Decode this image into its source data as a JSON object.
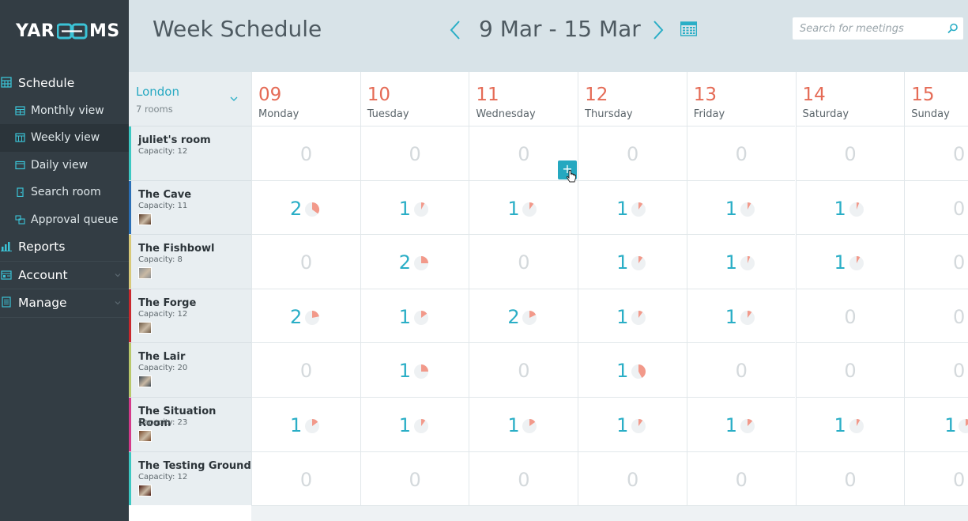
{
  "app": {
    "logo_left": "YAR",
    "logo_right": "MS",
    "page_title": "Week Schedule",
    "week_range": "9 Mar - 15 Mar",
    "search_placeholder": "Search for meetings",
    "accent_color": "#2aaec6",
    "date_color": "#e56b56"
  },
  "sidebar": {
    "items": [
      {
        "label": "Schedule",
        "type": "main",
        "icon": "schedule-icon"
      },
      {
        "label": "Monthly view",
        "type": "sub",
        "icon": "monthly-view-icon"
      },
      {
        "label": "Weekly view",
        "type": "sub",
        "icon": "weekly-view-icon",
        "active": true
      },
      {
        "label": "Daily view",
        "type": "sub",
        "icon": "daily-view-icon"
      },
      {
        "label": "Search room",
        "type": "sub",
        "icon": "search-room-icon"
      },
      {
        "label": "Approval queue",
        "type": "sub",
        "icon": "approval-queue-icon"
      },
      {
        "label": "Reports",
        "type": "main",
        "icon": "reports-icon"
      },
      {
        "label": "Account",
        "type": "main",
        "icon": "account-icon",
        "expandable": true
      },
      {
        "label": "Manage",
        "type": "main",
        "icon": "manage-icon",
        "expandable": true
      }
    ]
  },
  "location": {
    "name": "London",
    "rooms_label": "7 rooms"
  },
  "days": [
    {
      "num": "09",
      "name": "Monday"
    },
    {
      "num": "10",
      "name": "Tuesday"
    },
    {
      "num": "11",
      "name": "Wednesday"
    },
    {
      "num": "12",
      "name": "Thursday"
    },
    {
      "num": "13",
      "name": "Friday"
    },
    {
      "num": "14",
      "name": "Saturday"
    },
    {
      "num": "15",
      "name": "Sunday"
    }
  ],
  "rooms": [
    {
      "name": "juliet's room",
      "capacity": "Capacity: 12",
      "bar_color": "#3cc8c2",
      "thumb": false,
      "counts": [
        0,
        0,
        0,
        0,
        0,
        0,
        0
      ],
      "fill": [
        0,
        0,
        0,
        0,
        0,
        0,
        0
      ]
    },
    {
      "name": "The Cave",
      "capacity": "Capacity: 11",
      "bar_color": "#2b6fb5",
      "thumb": true,
      "counts": [
        2,
        1,
        1,
        1,
        1,
        1,
        0
      ],
      "fill": [
        0.35,
        0.08,
        0.1,
        0.1,
        0.08,
        0.06,
        0
      ]
    },
    {
      "name": "The Fishbowl",
      "capacity": "Capacity: 8",
      "bar_color": "#d8c978",
      "thumb": true,
      "counts": [
        0,
        2,
        0,
        1,
        1,
        1,
        0
      ],
      "fill": [
        0,
        0.25,
        0,
        0.1,
        0.06,
        0.08,
        0
      ]
    },
    {
      "name": "The Forge",
      "capacity": "Capacity: 12",
      "bar_color": "#c9282d",
      "thumb": true,
      "counts": [
        2,
        1,
        2,
        1,
        1,
        0,
        0
      ],
      "fill": [
        0.22,
        0.15,
        0.18,
        0.1,
        0.1,
        0,
        0
      ]
    },
    {
      "name": "The Lair",
      "capacity": "Capacity: 20",
      "bar_color": "#b9c86a",
      "thumb": true,
      "counts": [
        0,
        1,
        0,
        1,
        0,
        0,
        0
      ],
      "fill": [
        0,
        0.25,
        0,
        0.42,
        0,
        0,
        0
      ]
    },
    {
      "name": "The Situation Room",
      "capacity": "Capacity: 23",
      "bar_color": "#d43a8a",
      "thumb": true,
      "counts": [
        1,
        1,
        1,
        1,
        1,
        1,
        1
      ],
      "fill": [
        0.15,
        0.1,
        0.15,
        0.1,
        0.12,
        0.08,
        0.15
      ]
    },
    {
      "name": "The Testing Ground",
      "capacity": "Capacity: 12",
      "bar_color": "#3cc8c2",
      "thumb": true,
      "counts": [
        0,
        0,
        0,
        0,
        0,
        0,
        0
      ],
      "fill": [
        0,
        0,
        0,
        0,
        0,
        0,
        0
      ]
    }
  ],
  "add_button_label": "+"
}
